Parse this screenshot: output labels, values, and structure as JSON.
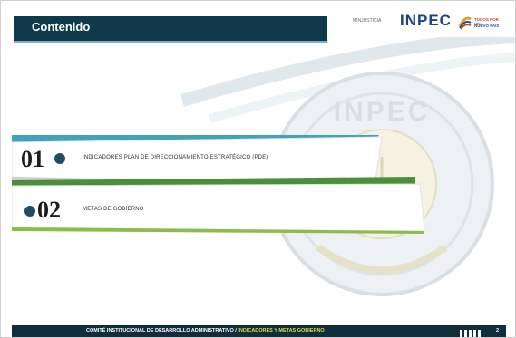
{
  "header": {
    "title": "Contenido"
  },
  "logos": {
    "ministerio": "MINJUSTICIA",
    "inpec": "INPEC",
    "gov_line1": "TODOS POR UN",
    "gov_line2": "NUEVO PAÍS"
  },
  "seal": {
    "text": "INPEC"
  },
  "items": [
    {
      "number": "01",
      "label": "INDICADORES  PLAN DE DIRECCIONAMIENTO   ESTRATÉGICO    (PDE)"
    },
    {
      "number": "02",
      "label": "METAS  DE GOBIERNO"
    }
  ],
  "footer": {
    "text": "COMITÉ INSTITUCIONAL DE DESARROLLO ADMINISTRATIVO / ",
    "highlight": "INDICADORES Y METAS GOBIERNO",
    "page": "2"
  },
  "colors": {
    "dark_teal": "#0e3a4b",
    "accent_teal": "#3fa3bf",
    "accent_green": "#4b8f3a",
    "footer_highlight": "#e2d640"
  }
}
